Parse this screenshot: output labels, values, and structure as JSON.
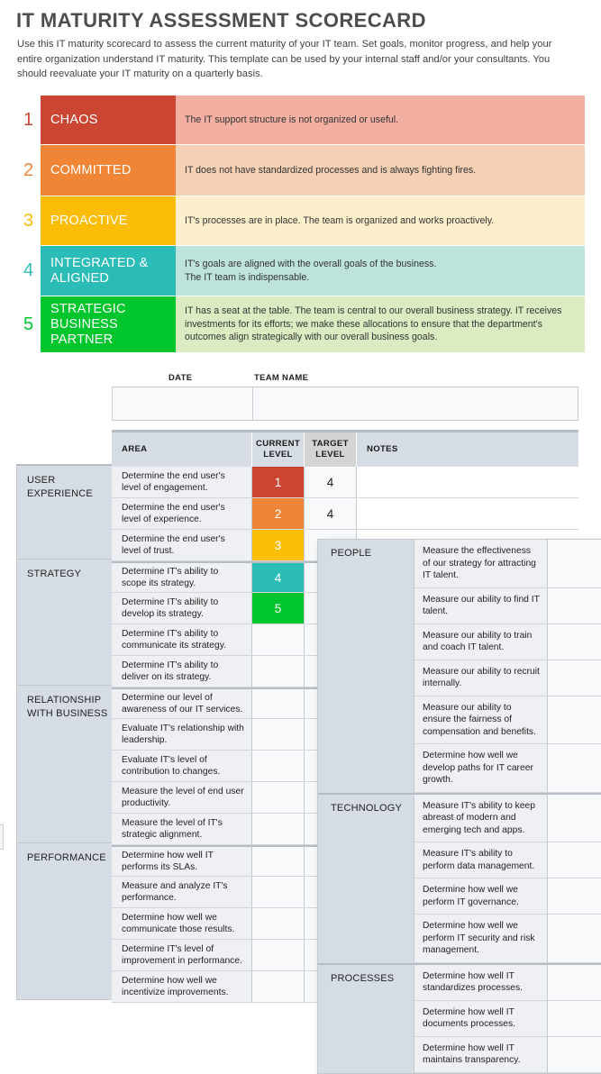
{
  "header": {
    "title": "IT MATURITY ASSESSMENT SCORECARD",
    "intro": "Use this IT maturity scorecard to assess the current maturity of your IT team. Set goals, monitor progress, and help your entire organization understand IT maturity. This template can be used by your internal staff and/or your consultants. You should reevaluate your IT maturity on a quarterly basis."
  },
  "maturity_levels": [
    {
      "number": "1",
      "name": "CHAOS",
      "description": "The IT support structure is not organized or useful.",
      "color": "#CB4533",
      "tint": "#F2AFA2"
    },
    {
      "number": "2",
      "name": "COMMITTED",
      "description": "IT does not have standardized processes and is always fighting fires.",
      "color": "#F08536",
      "tint": "#F6D0B4"
    },
    {
      "number": "3",
      "name": "PROACTIVE",
      "description": "IT's processes are in place. The team is organized and works proactively.",
      "color": "#FCBD09",
      "tint": "#FCEFCB"
    },
    {
      "number": "4",
      "name": "INTEGRATED & ALIGNED",
      "description": "IT's goals are aligned with the overall goals of the business.\nThe IT team is indispensable.",
      "color": "#2CBCB8",
      "tint": "#BDE3DC"
    },
    {
      "number": "5",
      "name": "STRATEGIC BUSINESS PARTNER",
      "description": "IT has a seat at the table. The team is central to our overall business strategy. IT receives investments for its efforts; we make these allocations to ensure that the department's outcomes align strategically with our overall business goals.",
      "color": "#00C62E",
      "tint": "#DBEBC2"
    }
  ],
  "meta": {
    "date_label": "DATE",
    "team_label": "TEAM NAME",
    "date_value": "",
    "team_value": "",
    "date_placeholder": "",
    "team_placeholder": ""
  },
  "table": {
    "columns": {
      "area": "AREA",
      "current_level": "CURRENT\nLEVEL",
      "current_level_line1": "CURRENT",
      "current_level_line2": "LEVEL",
      "target_level_line1": "TARGET",
      "target_level_line2": "LEVEL",
      "notes": "NOTES"
    },
    "groups": [
      {
        "name": "USER EXPERIENCE",
        "rows": [
          {
            "area": "Determine the end user's level of engagement.",
            "current": "1",
            "current_color": "#CB4533",
            "target": "4",
            "notes": ""
          },
          {
            "area": "Determine the end user's level of experience.",
            "current": "2",
            "current_color": "#F08536",
            "target": "4",
            "notes": ""
          },
          {
            "area": "Determine the end user's level of trust.",
            "current": "3",
            "current_color": "#FCBD09",
            "target": "",
            "notes": ""
          }
        ]
      },
      {
        "name": "STRATEGY",
        "rows": [
          {
            "area": "Determine IT's ability to scope its strategy.",
            "current": "4",
            "current_color": "#2CBCB8",
            "target": "",
            "notes": ""
          },
          {
            "area": "Determine IT's ability to develop its strategy.",
            "current": "5",
            "current_color": "#00C62E",
            "target": "",
            "notes": ""
          },
          {
            "area": "Determine IT's ability to communicate its strategy.",
            "current": "",
            "current_color": "",
            "target": "",
            "notes": ""
          },
          {
            "area": "Determine IT's ability to deliver on its strategy.",
            "current": "",
            "current_color": "",
            "target": "",
            "notes": ""
          }
        ]
      },
      {
        "name": "RELATIONSHIP WITH BUSINESS",
        "rows": [
          {
            "area": "Determine our level of awareness of our IT services.",
            "current": "",
            "current_color": "",
            "target": "",
            "notes": ""
          },
          {
            "area": "Evaluate IT's relationship with leadership.",
            "current": "",
            "current_color": "",
            "target": "",
            "notes": ""
          },
          {
            "area": "Evaluate IT's level of contribution to changes.",
            "current": "",
            "current_color": "",
            "target": "",
            "notes": ""
          },
          {
            "area": "Measure the level of end user productivity.",
            "current": "",
            "current_color": "",
            "target": "",
            "notes": ""
          },
          {
            "area": "Measure the level of IT's strategic alignment.",
            "current": "",
            "current_color": "",
            "target": "",
            "notes": ""
          }
        ]
      },
      {
        "name": "PERFORMANCE",
        "rows": [
          {
            "area": "Determine how well IT performs its SLAs.",
            "current": "",
            "current_color": "",
            "target": "",
            "notes": ""
          },
          {
            "area": "Measure and analyze IT's performance.",
            "current": "",
            "current_color": "",
            "target": "",
            "notes": ""
          },
          {
            "area": "Determine how well we communicate those results.",
            "current": "",
            "current_color": "",
            "target": "",
            "notes": ""
          },
          {
            "area": "Determine IT's level of improvement in performance.",
            "current": "",
            "current_color": "",
            "target": "",
            "notes": ""
          },
          {
            "area": "Determine how well we incentivize improvements.",
            "current": "",
            "current_color": "",
            "target": "",
            "notes": ""
          }
        ]
      }
    ]
  },
  "overlay_panel": {
    "groups": [
      {
        "name": "PEOPLE",
        "rows": [
          {
            "area": "Measure the effectiveness of our strategy for attracting IT talent.",
            "value": ""
          },
          {
            "area": "Measure our ability to find IT talent.",
            "value": ""
          },
          {
            "area": "Measure our ability to train and coach IT talent.",
            "value": ""
          },
          {
            "area": "Measure our ability to recruit internally.",
            "value": ""
          },
          {
            "area": "Measure our ability to ensure the fairness of compensation and benefits.",
            "value": ""
          },
          {
            "area": "Determine how well we develop paths for IT career growth.",
            "value": ""
          }
        ]
      },
      {
        "name": "TECHNOLOGY",
        "rows": [
          {
            "area": "Measure IT's ability to keep abreast of modern and emerging tech and apps.",
            "value": ""
          },
          {
            "area": "Measure IT's ability to perform data management.",
            "value": ""
          },
          {
            "area": "Determine how well we perform IT governance.",
            "value": ""
          },
          {
            "area": "Determine how well we perform IT security and risk management.",
            "value": ""
          }
        ]
      },
      {
        "name": "PROCESSES",
        "rows": [
          {
            "area": "Determine how well IT standardizes processes.",
            "value": ""
          },
          {
            "area": "Determine how well IT documents processes.",
            "value": ""
          },
          {
            "area": "Determine how well IT maintains transparency.",
            "value": ""
          }
        ]
      }
    ]
  }
}
